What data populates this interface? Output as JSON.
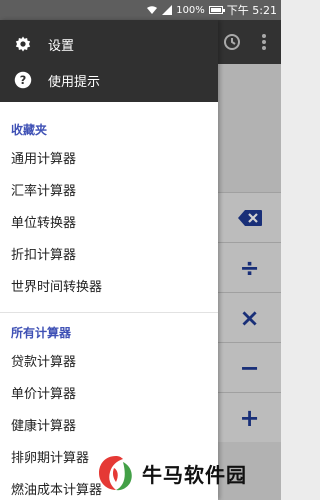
{
  "status_bar": {
    "battery": "100%",
    "time": "下午 5:21"
  },
  "appbar": {
    "history_icon": "history-icon",
    "more_icon": "more-vert-icon"
  },
  "calc_buttons": [
    {
      "name": "backspace-button",
      "symbol": "⌫"
    },
    {
      "name": "divide-button",
      "symbol": "÷"
    },
    {
      "name": "multiply-button",
      "symbol": "×"
    },
    {
      "name": "minus-button",
      "symbol": "−"
    },
    {
      "name": "plus-button",
      "symbol": "+"
    }
  ],
  "drawer": {
    "header": {
      "settings_label": "设置",
      "tips_label": "使用提示"
    },
    "favorites_title": "收藏夹",
    "favorites": [
      "通用计算器",
      "汇率计算器",
      "单位转换器",
      "折扣计算器",
      "世界时间转换器"
    ],
    "all_title": "所有计算器",
    "all": [
      "贷款计算器",
      "单价计算器",
      "健康计算器",
      "排卵期计算器",
      "燃油成本计算器"
    ]
  },
  "watermark": {
    "text": "牛马软件园"
  },
  "colors": {
    "accent": "#3f51b5",
    "calc_symbol": "#1f3a93",
    "drawer_header": "#303030"
  }
}
